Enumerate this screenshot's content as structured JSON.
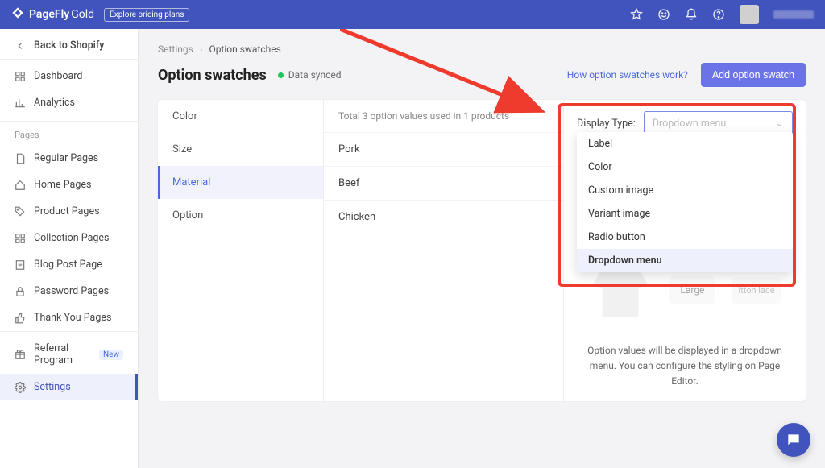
{
  "brand": {
    "name": "PageFly",
    "tier": "Gold",
    "explore": "Explore pricing plans"
  },
  "sidebar": {
    "back": "Back to Shopify",
    "dashboard": "Dashboard",
    "analytics": "Analytics",
    "pages_header": "Pages",
    "pages": [
      "Regular Pages",
      "Home Pages",
      "Product Pages",
      "Collection Pages",
      "Blog Post Page",
      "Password Pages",
      "Thank You Pages"
    ],
    "referral": "Referral Program",
    "referral_badge": "New",
    "settings": "Settings"
  },
  "breadcrumb": {
    "root": "Settings",
    "current": "Option swatches"
  },
  "header": {
    "title": "Option swatches",
    "status": "Data synced",
    "help_link": "How option swatches work?",
    "add_button": "Add option swatch"
  },
  "tabs": [
    "Color",
    "Size",
    "Material",
    "Option"
  ],
  "active_tab": 2,
  "values_summary": "Total 3 option values used in 1 products",
  "option_values": [
    "Pork",
    "Beef",
    "Chicken"
  ],
  "display_type": {
    "label": "Display Type:",
    "placeholder": "Dropdown menu",
    "options": [
      "Label",
      "Color",
      "Custom image",
      "Variant image",
      "Radio button",
      "Dropdown menu"
    ],
    "selected": "Dropdown menu"
  },
  "preview": {
    "chip_large": "Large",
    "chip_small": "itton lace"
  },
  "description": "Option values will be displayed in a dropdown menu. You can configure the styling on Page Editor."
}
